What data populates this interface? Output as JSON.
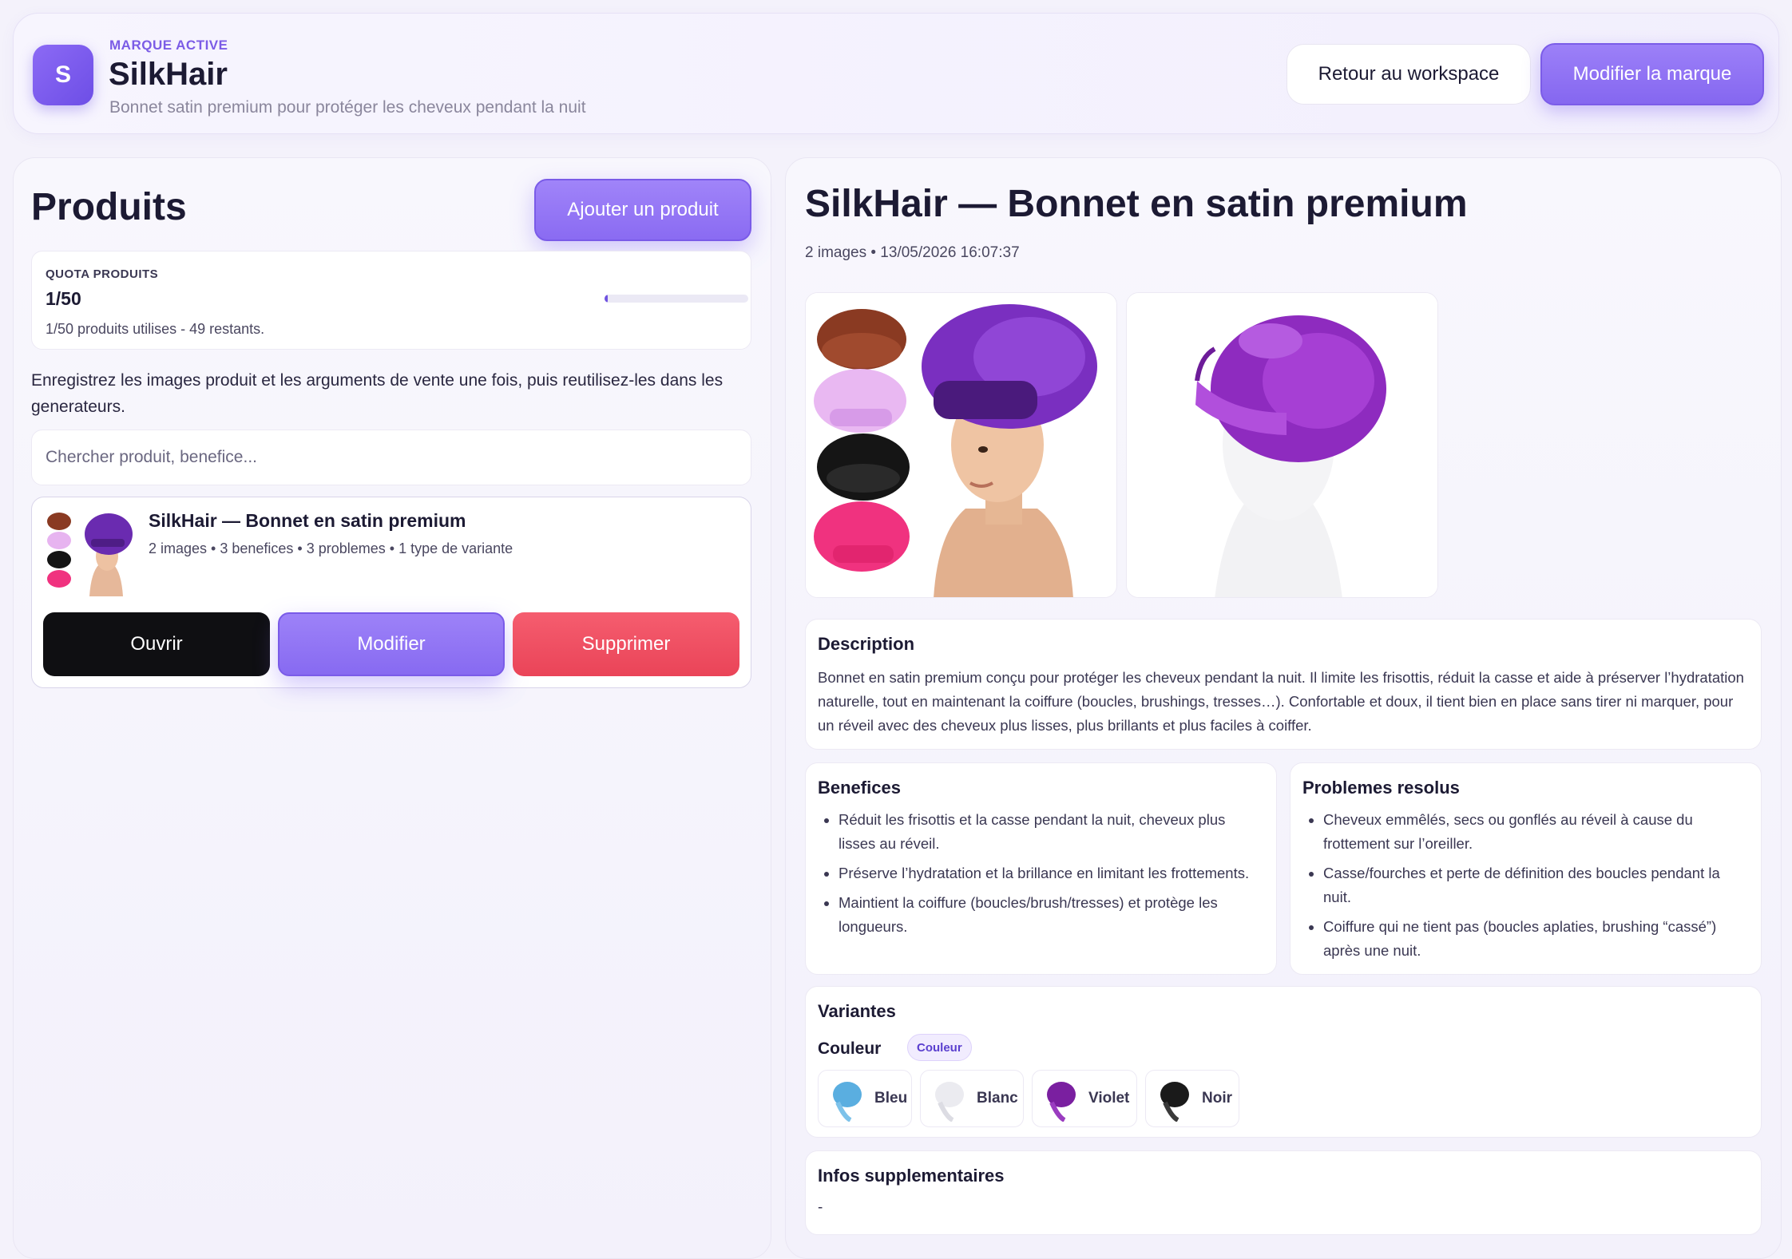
{
  "brand": {
    "initial": "S",
    "kicker": "MARQUE ACTIVE",
    "name": "SilkHair",
    "tagline": "Bonnet satin premium pour protéger les cheveux pendant la nuit",
    "back_label": "Retour au workspace",
    "edit_label": "Modifier la marque"
  },
  "colors": {
    "accent": "#8a6bf2",
    "danger": "#ea4458",
    "dark": "#0f0f12"
  },
  "products": {
    "title": "Produits",
    "add_label": "Ajouter un produit",
    "quota": {
      "label": "QUOTA PRODUITS",
      "value": "1/50",
      "text": "1/50 produits utilises - 49 restants.",
      "used_fraction": 0.02
    },
    "intro": "Enregistrez les images produit et les arguments de vente une fois, puis reutilisez-les dans les generateurs.",
    "search_placeholder": "Chercher produit, benefice...",
    "items": [
      {
        "name": "SilkHair — Bonnet en satin premium",
        "meta": "2 images • 3 benefices • 3 problemes • 1 type de variante",
        "open_label": "Ouvrir",
        "edit_label": "Modifier",
        "delete_label": "Supprimer"
      }
    ]
  },
  "detail": {
    "title": "SilkHair — Bonnet en satin premium",
    "meta": "2 images • 13/05/2026 16:07:37",
    "description": {
      "title": "Description",
      "text": "Bonnet en satin premium conçu pour protéger les cheveux pendant la nuit. Il limite les frisottis, réduit la casse et aide à préserver l’hydratation naturelle, tout en maintenant la coiffure (boucles, brushings, tresses…). Confortable et doux, il tient bien en place sans tirer ni marquer, pour un réveil avec des cheveux plus lisses, plus brillants et plus faciles à coiffer."
    },
    "benefits": {
      "title": "Benefices",
      "items": [
        "Réduit les frisottis et la casse pendant la nuit, cheveux plus lisses au réveil.",
        "Préserve l’hydratation et la brillance en limitant les frottements.",
        "Maintient la coiffure (boucles/brush/tresses) et protège les longueurs."
      ]
    },
    "problems": {
      "title": "Problemes resolus",
      "items": [
        "Cheveux emmêlés, secs ou gonflés au réveil à cause du frottement sur l’oreiller.",
        "Casse/fourches et perte de définition des boucles pendant la nuit.",
        "Coiffure qui ne tient pas (boucles aplaties, brushing “cassé”) après une nuit."
      ]
    },
    "variants": {
      "title": "Variantes",
      "group": "Couleur",
      "badge": "Couleur",
      "options": [
        {
          "label": "Bleu",
          "color": "#5aaee0"
        },
        {
          "label": "Blanc",
          "color": "#e9e9ee"
        },
        {
          "label": "Violet",
          "color": "#7a1fa0"
        },
        {
          "label": "Noir",
          "color": "#1a1a1a"
        }
      ]
    },
    "infos": {
      "title": "Infos supplementaires",
      "value": "-"
    }
  }
}
